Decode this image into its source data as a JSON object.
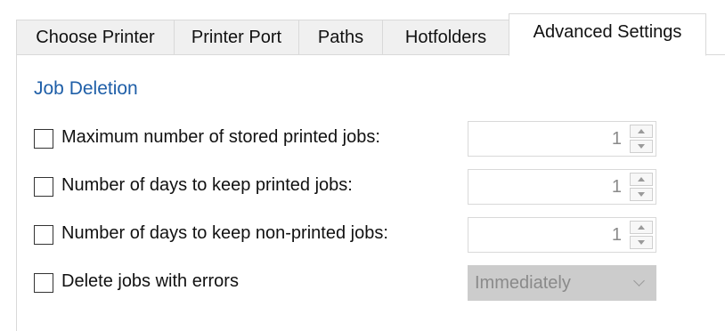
{
  "tabs": [
    {
      "label": "Choose Printer",
      "active": false
    },
    {
      "label": "Printer Port",
      "active": false
    },
    {
      "label": "Paths",
      "active": false
    },
    {
      "label": "Hotfolders",
      "active": false
    },
    {
      "label": "Advanced Settings",
      "active": true
    }
  ],
  "job_deletion": {
    "title": "Job Deletion",
    "rows": [
      {
        "label": "Maximum number of stored printed jobs:",
        "checked": false,
        "value": "1",
        "enabled": false
      },
      {
        "label": "Number of days to keep printed jobs:",
        "checked": false,
        "value": "1",
        "enabled": false
      },
      {
        "label": "Number of days to keep non-printed jobs:",
        "checked": false,
        "value": "1",
        "enabled": false
      }
    ],
    "delete_errors": {
      "label": "Delete jobs with errors",
      "checked": false,
      "selected": "Immediately",
      "enabled": false
    }
  },
  "colors": {
    "group_title": "#1f5fa8",
    "disabled_text": "#8a8a8a",
    "border": "#d9d9d9"
  }
}
